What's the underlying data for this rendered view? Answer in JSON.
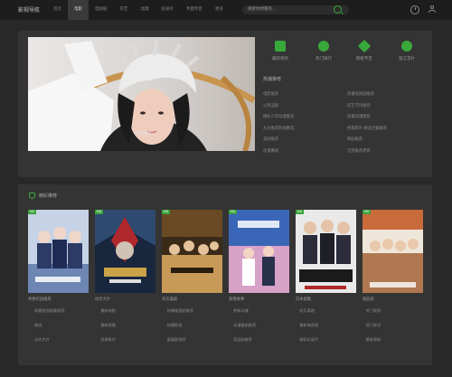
{
  "header": {
    "logo": "影视导航",
    "nav": [
      "首页",
      "电影",
      "电视剧",
      "综艺",
      "动漫",
      "纪录片",
      "专题专区",
      "更多"
    ],
    "search_placeholder": "搜索你想看的..."
  },
  "hero": {
    "caption": "影视推荐",
    "quick_links": [
      "最新更新",
      "热门排行",
      "明星专区",
      "留言求片"
    ],
    "side_title": "热播推荐",
    "side_items": [
      "电影推荐",
      "热播电视剧推荐",
      "火热追剧",
      "综艺节目推荐",
      "精彩少年动漫推荐",
      "热播动漫推荐",
      "九龙推荐影视精选",
      "经典影片 精选合集推荐",
      "美剧推荐",
      "韩剧推荐",
      "动漫番剧",
      "全部推荐更新"
    ]
  },
  "section": {
    "title": "精彩推荐",
    "badge": "HD",
    "posters": [
      {
        "title": "青春校园推荐",
        "colors": [
          "#c6d3e6",
          "#2c3a66"
        ]
      },
      {
        "title": "动作大片",
        "colors": [
          "#18263e",
          "#b0272c"
        ]
      },
      {
        "title": "欢乐喜剧",
        "colors": [
          "#3b2a18",
          "#c89a57"
        ]
      },
      {
        "title": "爱情故事",
        "colors": [
          "#3a66b8",
          "#d7a2c8"
        ]
      },
      {
        "title": "日本剧集",
        "colors": [
          "#e9e9e9",
          "#2c2c3a"
        ]
      },
      {
        "title": "家庭剧",
        "colors": [
          "#c96a3a",
          "#efe6da"
        ]
      }
    ]
  },
  "footer_links": [
    "青春校园剧集推荐",
    "最新电影",
    "热播电视剧推荐",
    "更新动漫",
    "欢乐喜剧",
    "热门推荐",
    "精选",
    "最新剧集",
    "热播影视",
    "动漫番剧推荐",
    "最新电视剧",
    "热门综艺",
    "动作大片",
    "经典影片",
    "悬疑剧推荐",
    "家庭剧推荐",
    "精彩纪录片",
    "最新更新"
  ]
}
